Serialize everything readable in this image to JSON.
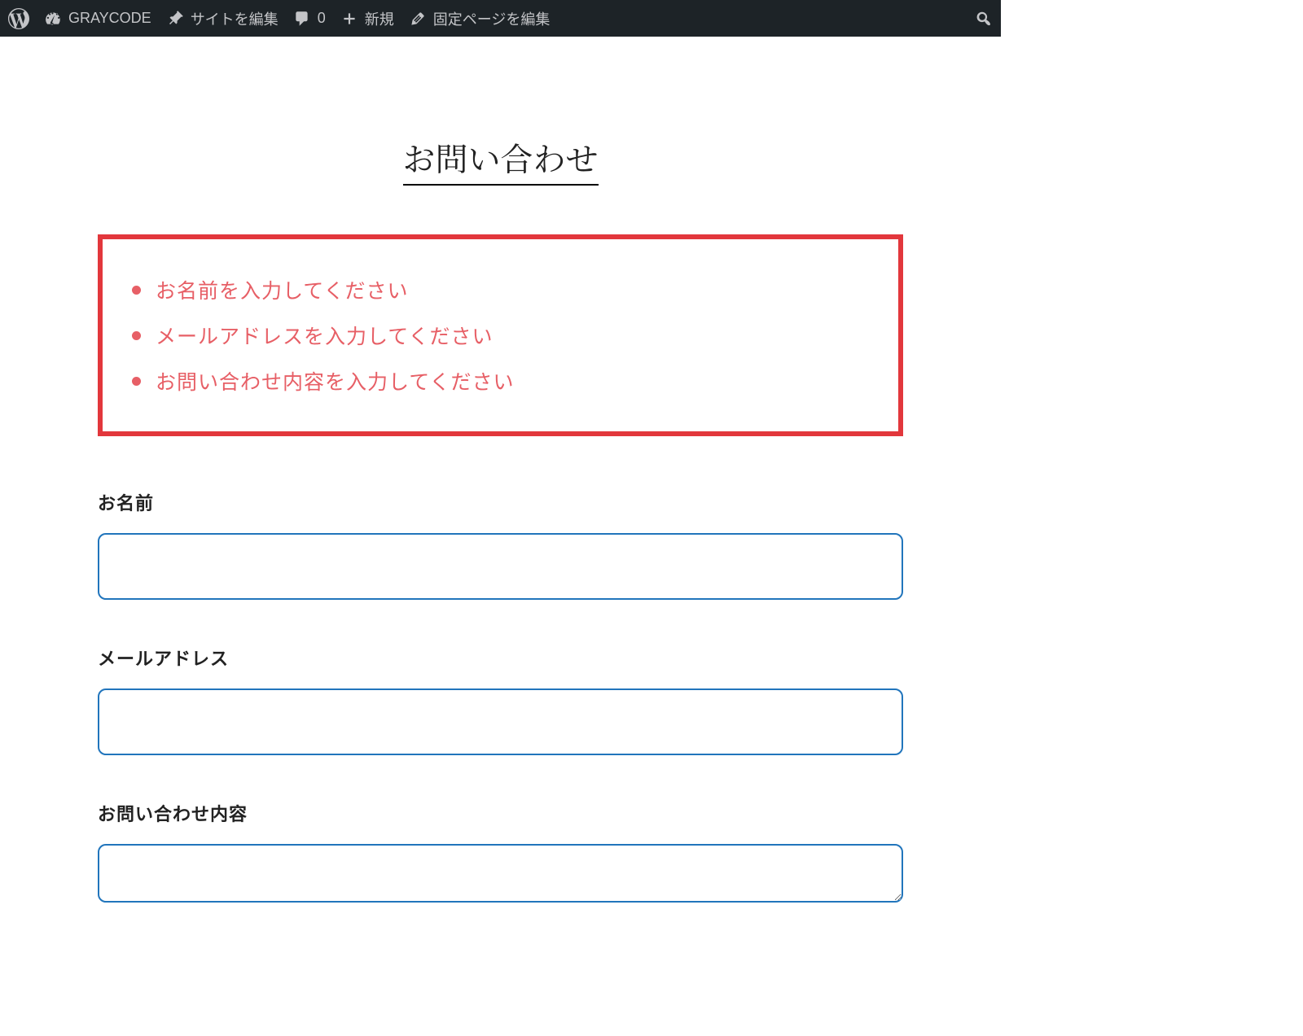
{
  "admin_bar": {
    "site_name": "GRAYCODE",
    "edit_site": "サイトを編集",
    "comments_count": "0",
    "new_item": "新規",
    "edit_page": "固定ページを編集"
  },
  "page": {
    "title": "お問い合わせ"
  },
  "errors": [
    "お名前を入力してください",
    "メールアドレスを入力してください",
    "お問い合わせ内容を入力してください"
  ],
  "form": {
    "name": {
      "label": "お名前",
      "value": ""
    },
    "email": {
      "label": "メールアドレス",
      "value": ""
    },
    "message": {
      "label": "お問い合わせ内容",
      "value": ""
    }
  }
}
